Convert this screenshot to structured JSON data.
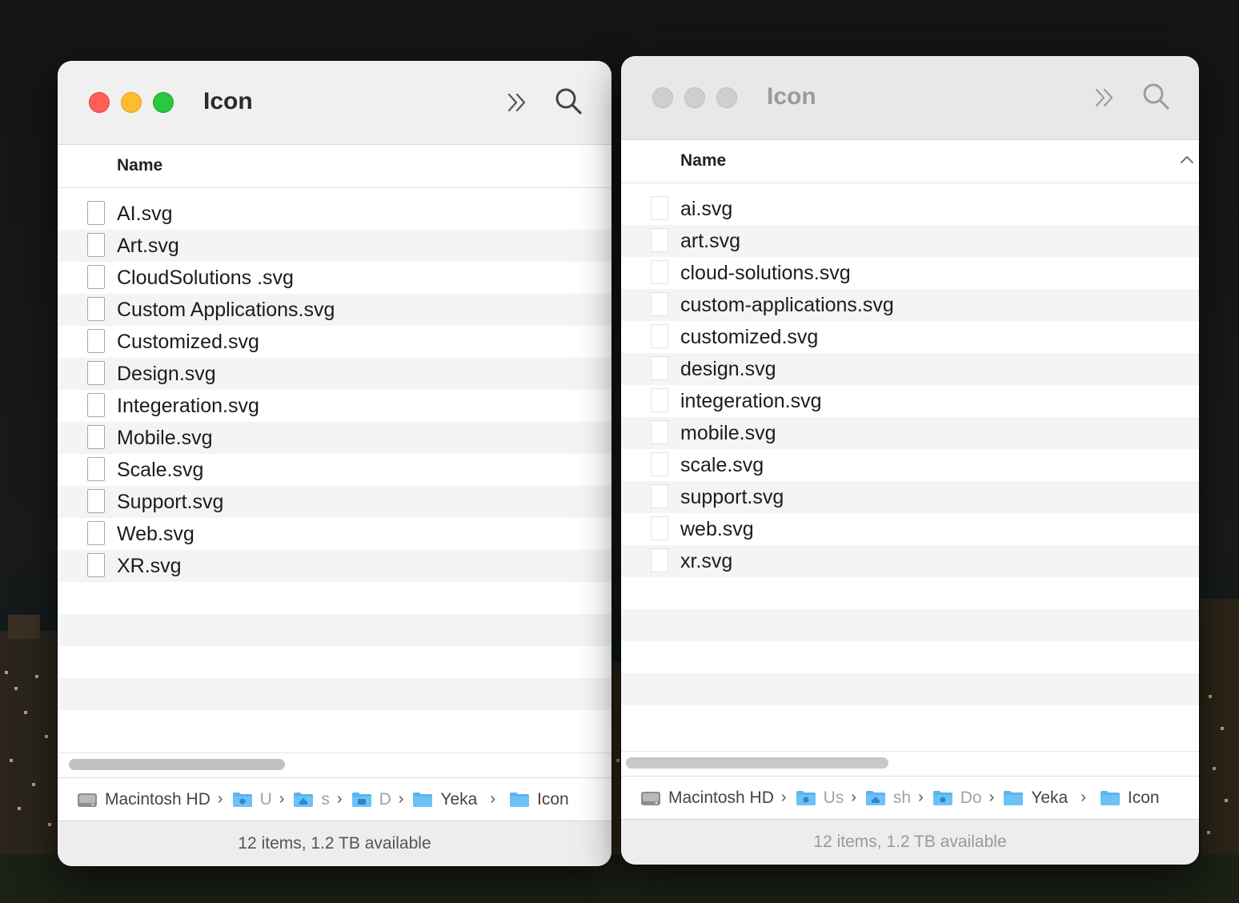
{
  "window_left": {
    "title": "Icon",
    "column_header": "Name",
    "files": [
      "AI.svg",
      "Art.svg",
      "CloudSolutions .svg",
      "Custom Applications.svg",
      "Customized.svg",
      "Design.svg",
      "Integeration.svg",
      "Mobile.svg",
      "Scale.svg",
      "Support.svg",
      "Web.svg",
      "XR.svg"
    ],
    "path": {
      "disk": "Macintosh HD",
      "users": "U",
      "home": "s",
      "docs": "D",
      "parent": "Yeka",
      "current": "Icon"
    },
    "status": "12 items, 1.2 TB available"
  },
  "window_right": {
    "title": "Icon",
    "column_header": "Name",
    "files": [
      "ai.svg",
      "art.svg",
      "cloud-solutions.svg",
      "custom-applications.svg",
      "customized.svg",
      "design.svg",
      "integeration.svg",
      "mobile.svg",
      "scale.svg",
      "support.svg",
      "web.svg",
      "xr.svg"
    ],
    "path": {
      "disk": "Macintosh HD",
      "users": "Us",
      "home": "sh",
      "docs": "Do",
      "parent": "Yeka",
      "current": "Icon"
    },
    "status": "12 items, 1.2 TB available"
  },
  "colors": {
    "close": "#ff5f57",
    "minimize": "#febc2e",
    "zoom": "#28c840",
    "folder": "#5ab4f0"
  },
  "icons": [
    "chevron-double-right-icon",
    "search-icon",
    "document-icon",
    "hard-disk-icon",
    "folder-icon",
    "sort-ascending-icon"
  ]
}
